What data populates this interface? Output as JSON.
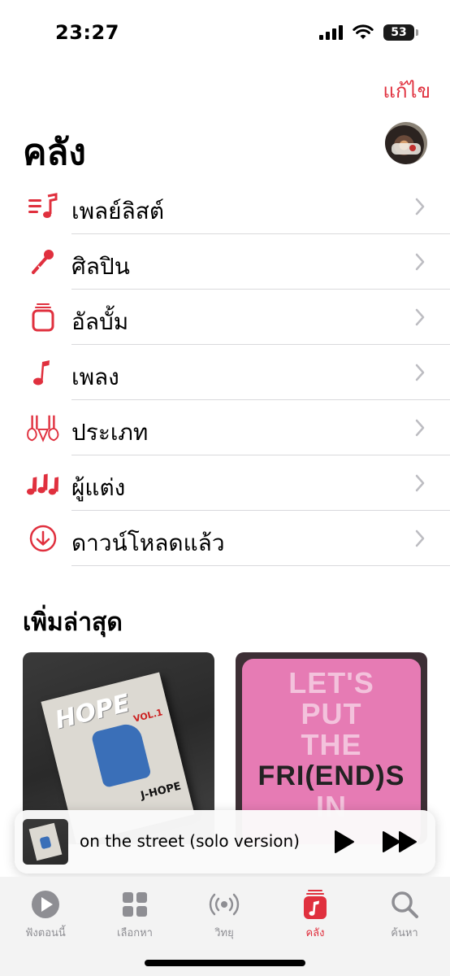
{
  "status_bar": {
    "time": "23:27",
    "battery": "53"
  },
  "header": {
    "edit": "แก้ไข",
    "title": "คลัง"
  },
  "library_items": [
    {
      "label": "เพลย์ลิสต์",
      "icon": "playlist-icon"
    },
    {
      "label": "ศิลปิน",
      "icon": "microphone-icon"
    },
    {
      "label": "อัลบั้ม",
      "icon": "album-icon"
    },
    {
      "label": "เพลง",
      "icon": "music-note-icon"
    },
    {
      "label": "ประเภท",
      "icon": "genre-icon"
    },
    {
      "label": "ผู้แต่ง",
      "icon": "composer-icon"
    },
    {
      "label": "ดาวน์โหลดแล้ว",
      "icon": "download-icon"
    }
  ],
  "recently_added": {
    "title": "เพิ่มล่าสุด",
    "albums": [
      {
        "cover_text": [
          "HOPE",
          "VOL.1",
          "J-HOPE"
        ]
      },
      {
        "cover_text": [
          "LET'S",
          "PUT",
          "THE",
          "FRI(END)S",
          "IN"
        ]
      }
    ]
  },
  "now_playing": {
    "title": "on the street (solo version)"
  },
  "tabs": [
    {
      "label": "ฟังตอนนี้",
      "icon": "play-circle-icon",
      "active": false
    },
    {
      "label": "เลือกหา",
      "icon": "grid-icon",
      "active": false
    },
    {
      "label": "วิทยุ",
      "icon": "radio-icon",
      "active": false
    },
    {
      "label": "คลัง",
      "icon": "library-icon",
      "active": true
    },
    {
      "label": "ค้นหา",
      "icon": "search-icon",
      "active": false
    }
  ],
  "colors": {
    "accent": "#e0303e",
    "divider": "#d9d9dc",
    "tab_inactive": "#8e8e93"
  }
}
